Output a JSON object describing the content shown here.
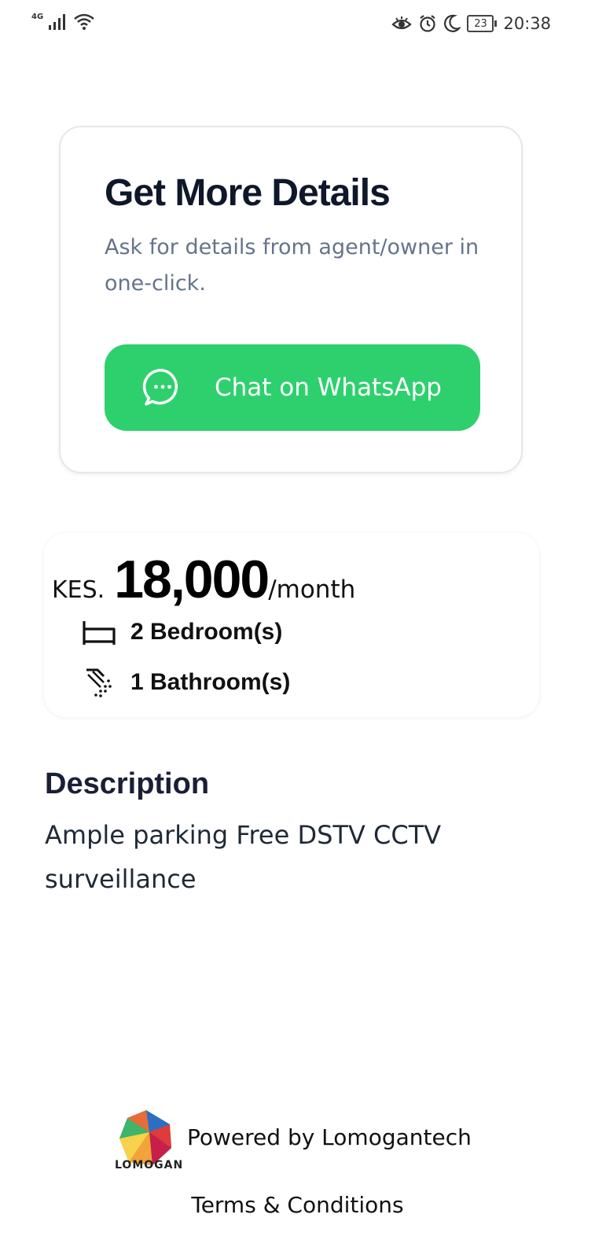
{
  "status_bar": {
    "network": "4G",
    "battery": "23",
    "time": "20:38"
  },
  "details_card": {
    "title": "Get More Details",
    "subtitle": "Ask for details from agent/owner in one-click.",
    "button_label": "Chat on WhatsApp",
    "button_color": "#2ed06e"
  },
  "listing": {
    "currency": "KES.",
    "price": "18,000",
    "period": "/month",
    "bedrooms": "2 Bedroom(s)",
    "bathrooms": "1 Bathroom(s)"
  },
  "description": {
    "heading": "Description",
    "text": "Ample parking Free DSTV CCTV surveillance"
  },
  "footer": {
    "logo_text": "LOMOGAN",
    "powered_by": "Powered by Lomogantech",
    "terms": "Terms & Conditions"
  }
}
